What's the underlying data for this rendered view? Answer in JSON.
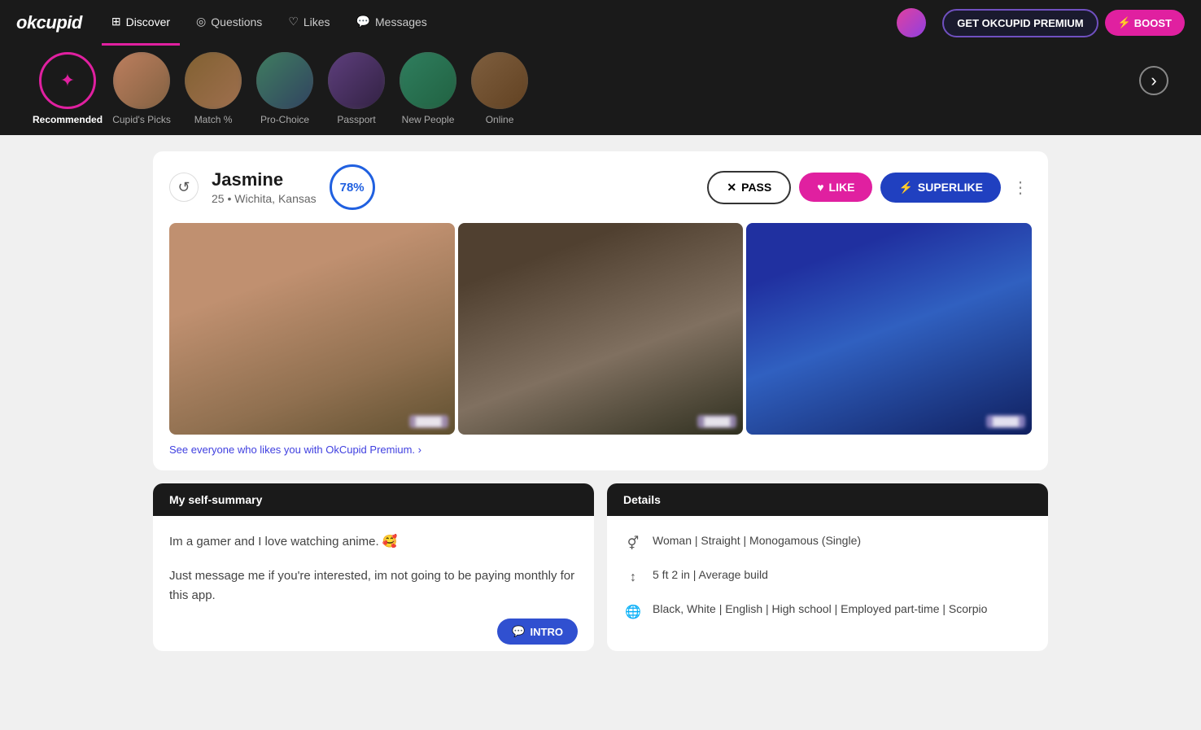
{
  "brand": "okcupid",
  "nav": {
    "items": [
      {
        "label": "Discover",
        "icon": "discover-icon",
        "active": true
      },
      {
        "label": "Questions",
        "icon": "questions-icon",
        "active": false
      },
      {
        "label": "Likes",
        "icon": "likes-icon",
        "active": false
      },
      {
        "label": "Messages",
        "icon": "messages-icon",
        "active": false
      }
    ],
    "premium_label": "GET OKCUPID PREMIUM",
    "boost_label": "BOOST"
  },
  "categories": [
    {
      "label": "Recommended",
      "active": true,
      "icon": "sun"
    },
    {
      "label": "Cupid's Picks",
      "active": false
    },
    {
      "label": "Match %",
      "active": false
    },
    {
      "label": "Pro-Choice",
      "active": false
    },
    {
      "label": "Passport",
      "active": false
    },
    {
      "label": "New People",
      "active": false
    },
    {
      "label": "Online",
      "active": false
    }
  ],
  "profile": {
    "name": "Jasmine",
    "age": "25",
    "location": "Wichita, Kansas",
    "match_percent": "78%",
    "pass_label": "PASS",
    "like_label": "LIKE",
    "superlike_label": "SUPERLIKE",
    "premium_prompt": "See everyone who likes you with OkCupid Premium. ›",
    "self_summary_header": "My self-summary",
    "self_summary_text1": "Im a gamer and I love watching anime. 🥰",
    "self_summary_text2": "Just message me if you're interested, im not going to be paying monthly for this app.",
    "intro_label": "INTRO",
    "details_header": "Details",
    "detail1": "Woman | Straight | Monogamous (Single)",
    "detail2": "5 ft 2 in | Average build",
    "detail3": "Black, White | English | High school | Employed part-time | Scorpio"
  }
}
